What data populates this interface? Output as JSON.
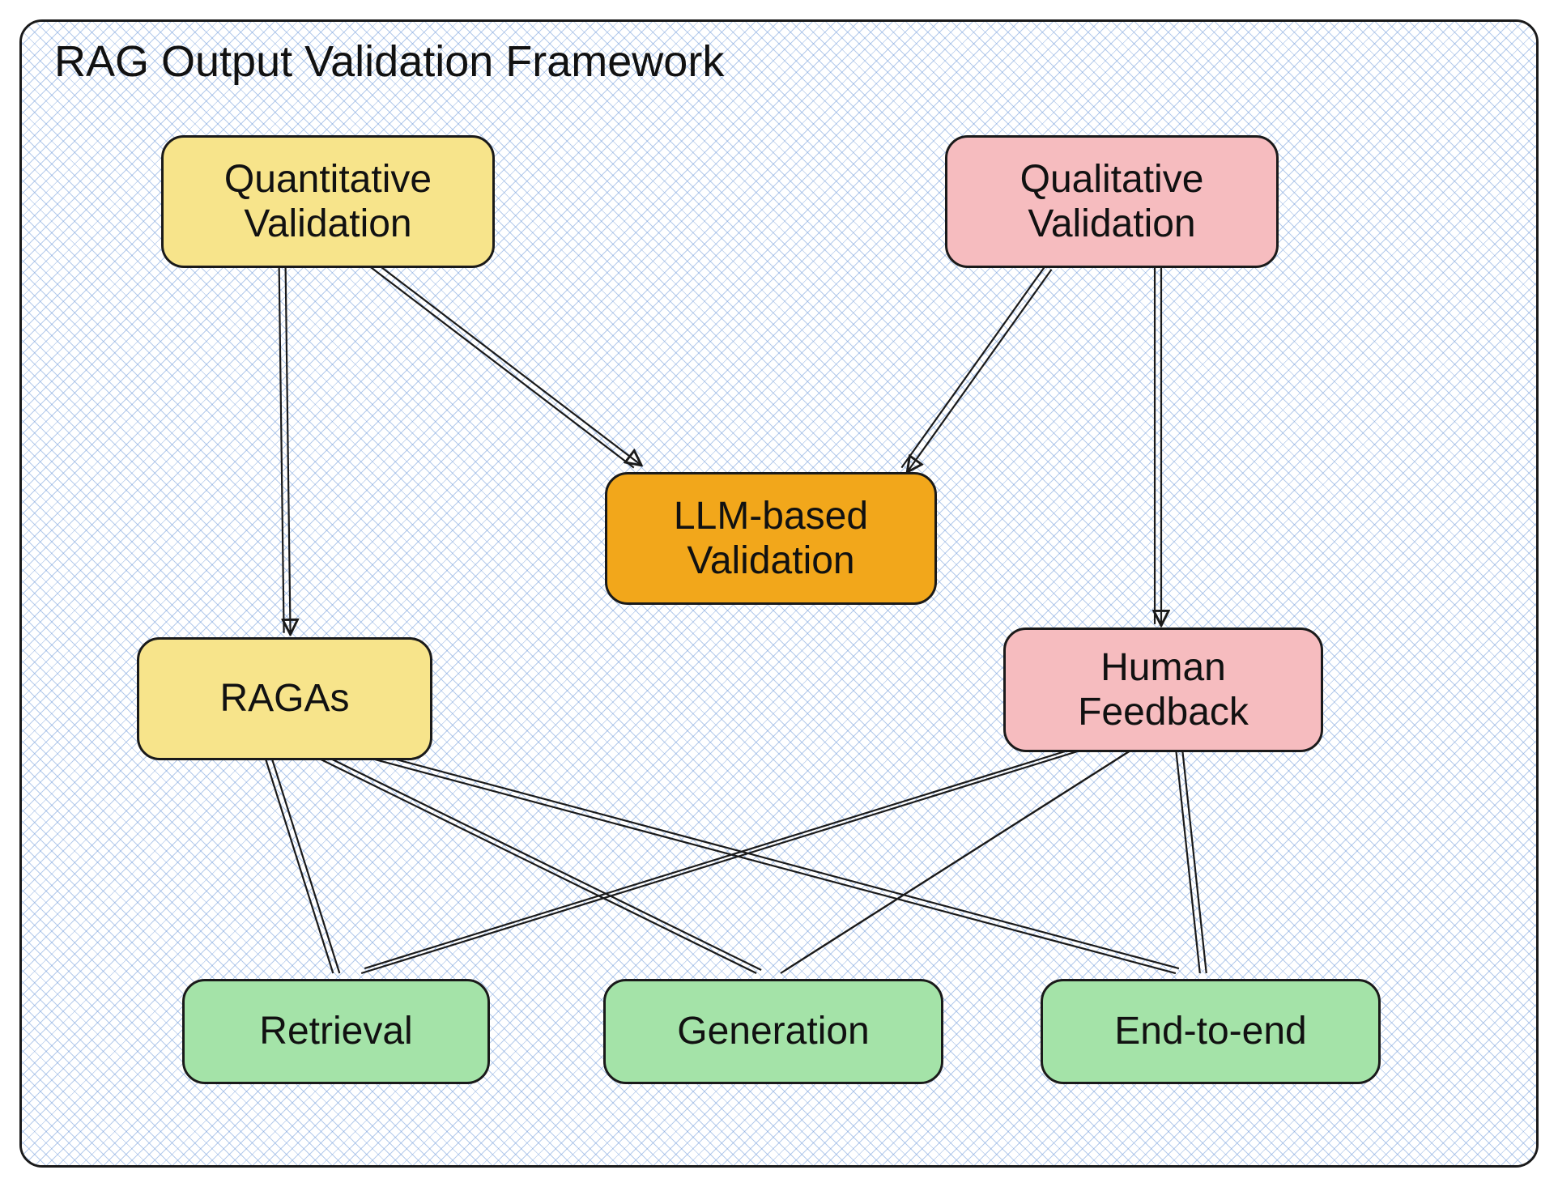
{
  "diagram": {
    "title": "RAG Output Validation Framework",
    "nodes": {
      "quantitative": "Quantitative\nValidation",
      "qualitative": "Qualitative\nValidation",
      "llm": "LLM-based\nValidation",
      "ragas": "RAGAs",
      "human": "Human\nFeedback",
      "retrieval": "Retrieval",
      "generation": "Generation",
      "endtoend": "End-to-end"
    },
    "edges_arrowed": [
      [
        "quantitative",
        "ragas"
      ],
      [
        "quantitative",
        "llm"
      ],
      [
        "qualitative",
        "llm"
      ],
      [
        "qualitative",
        "human"
      ]
    ],
    "edges_plain": [
      [
        "ragas",
        "retrieval"
      ],
      [
        "ragas",
        "generation"
      ],
      [
        "ragas",
        "endtoend"
      ],
      [
        "human",
        "retrieval"
      ],
      [
        "human",
        "generation"
      ],
      [
        "human",
        "endtoend"
      ]
    ],
    "node_colors": {
      "quantitative": "yellow",
      "qualitative": "pink",
      "llm": "orange",
      "ragas": "yellow",
      "human": "pink",
      "retrieval": "green",
      "generation": "green",
      "endtoend": "green"
    }
  }
}
